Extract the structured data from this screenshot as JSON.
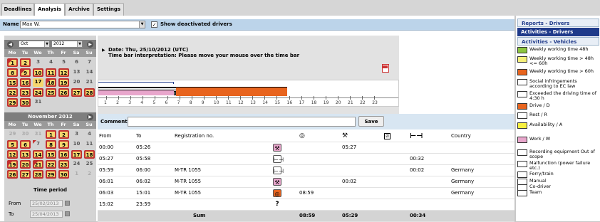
{
  "tabs": [
    "Deadlines",
    "Analysis",
    "Archive",
    "Settings"
  ],
  "name_label": "Name",
  "name_value": "Max W.",
  "show_deactivated": "Show deactivated drivers",
  "cal1": {
    "month": "Oct",
    "year": "2012"
  },
  "daynames": [
    "Mo",
    "Tu",
    "We",
    "Th",
    "Fr",
    "Sa",
    "Su"
  ],
  "cal2": {
    "title": "November 2012"
  },
  "time_period": {
    "title": "Time period",
    "from_label": "From",
    "from": "25/02/2013",
    "to_label": "To",
    "to": "25/04/2013"
  },
  "date_line": "Date: Thu, 25/10/2012 (UTC)",
  "interp": "Time bar interpretation: Please move your mouse over the time bar",
  "hours": [
    "1",
    "2",
    "3",
    "4",
    "5",
    "6",
    "7",
    "8",
    "9",
    "10",
    "11",
    "12",
    "13",
    "14",
    "15",
    "16",
    "17",
    "18",
    "19",
    "20",
    "21",
    "22",
    "23"
  ],
  "comment_label": "Comment",
  "save_label": "Save",
  "headers": [
    "From",
    "To",
    "Registration no.",
    "",
    "",
    "",
    "",
    "",
    "Country"
  ],
  "rows": [
    {
      "from": "00:00",
      "to": "05:26",
      "reg": "",
      "icon": "work",
      "drive": "",
      "work": "05:27",
      "avail": "",
      "rest": "",
      "country": ""
    },
    {
      "from": "05:27",
      "to": "05:58",
      "reg": "",
      "icon": "rest",
      "drive": "",
      "work": "",
      "avail": "",
      "rest": "00:32",
      "country": ""
    },
    {
      "from": "05:59",
      "to": "06:00",
      "reg": "M-TR 1055",
      "icon": "rest",
      "drive": "",
      "work": "",
      "avail": "",
      "rest": "00:02",
      "country": "Germany"
    },
    {
      "from": "06:01",
      "to": "06:02",
      "reg": "M-TR 1055",
      "icon": "work",
      "drive": "",
      "work": "00:02",
      "avail": "",
      "rest": "",
      "country": "Germany"
    },
    {
      "from": "06:03",
      "to": "15:01",
      "reg": "M-TR 1055",
      "icon": "drive",
      "drive": "08:59",
      "work": "",
      "avail": "",
      "rest": "",
      "country": "Germany"
    },
    {
      "from": "15:02",
      "to": "23:59",
      "reg": "",
      "icon": "unknown",
      "drive": "",
      "work": "",
      "avail": "",
      "rest": "",
      "country": ""
    }
  ],
  "sum": {
    "label": "Sum",
    "drive": "08:59",
    "work": "05:29",
    "rest": "00:34"
  },
  "right_buttons": [
    "Reports - Drivers",
    "Activities - Drivers",
    "Activities - Vehicles"
  ],
  "legend": [
    {
      "color": "#8dc63f",
      "label": "Weekly working time 48h"
    },
    {
      "color": "#f6f07a",
      "label": "Weekly working time > 48h <= 60h"
    },
    {
      "color": "#e8641e",
      "label": "Weekly working time > 60h"
    },
    {
      "color": "#ffffff",
      "label": "Social infringements according to EC law"
    },
    {
      "color": "#ffffff",
      "label": "Exceeded the driving time of 4:30 h"
    },
    {
      "color": "#e8641e",
      "label": "Drive / D"
    },
    {
      "color": "#ffffff",
      "label": "Rest / R"
    },
    {
      "color": "#f8f040",
      "label": "Availability / A"
    },
    {
      "color": "#e8a6cc",
      "label": "Work / W"
    },
    {
      "color": "#ffffff",
      "label": "Recording equipment Out of scope"
    },
    {
      "color": "#ffffff",
      "label": "Malfunction (power failure etc.)"
    },
    {
      "color": "#ffffff",
      "label": "Ferry/train"
    },
    {
      "color": "#ffffff",
      "label": "Manual"
    },
    {
      "color": "#ffffff",
      "label": "Co-driver"
    },
    {
      "color": "#ffffff",
      "label": "Team"
    }
  ]
}
